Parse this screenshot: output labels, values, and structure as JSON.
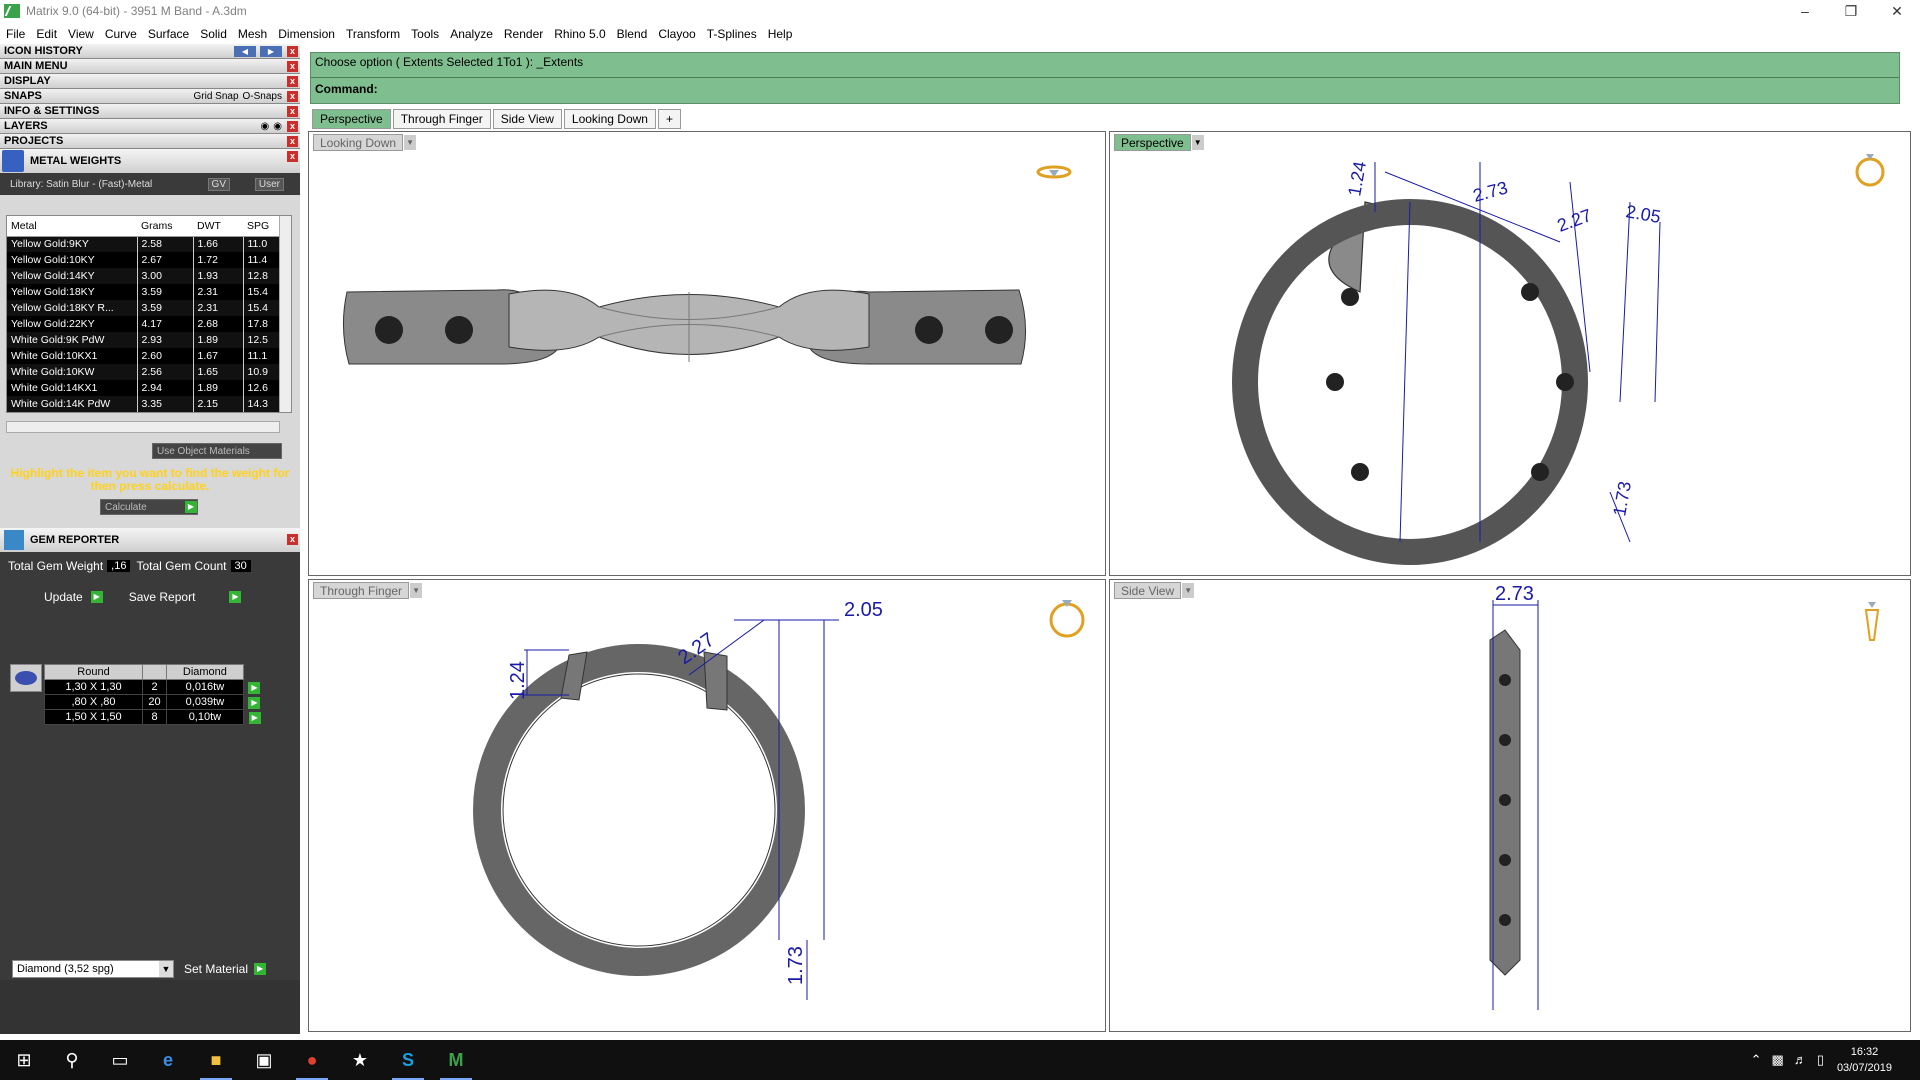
{
  "window": {
    "title": "Matrix 9.0 (64-bit) - 3951 M Band - A.3dm"
  },
  "menu": [
    "File",
    "Edit",
    "View",
    "Curve",
    "Surface",
    "Solid",
    "Mesh",
    "Dimension",
    "Transform",
    "Tools",
    "Analyze",
    "Render",
    "Rhino 5.0",
    "Blend",
    "Clayoo",
    "T-Splines",
    "Help"
  ],
  "panels": {
    "icon_history": "ICON HISTORY",
    "main_menu": "MAIN MENU",
    "display": "DISPLAY",
    "snaps": "SNAPS",
    "grid_snap": "Grid Snap",
    "o_snaps": "O-Snaps",
    "info_settings": "INFO & SETTINGS",
    "layers": "LAYERS",
    "projects": "PROJECTS"
  },
  "metal_weights": {
    "title": "METAL WEIGHTS",
    "library": "Library: Satin Blur - (Fast)-Metal",
    "gv": "GV",
    "user": "User",
    "headers": [
      "Metal",
      "Grams",
      "DWT",
      "SPG"
    ],
    "rows": [
      [
        "Yellow Gold:9KY",
        "2.58",
        "1.66",
        "11.0"
      ],
      [
        "Yellow Gold:10KY",
        "2.67",
        "1.72",
        "11.4"
      ],
      [
        "Yellow Gold:14KY",
        "3.00",
        "1.93",
        "12.8"
      ],
      [
        "Yellow Gold:18KY",
        "3.59",
        "2.31",
        "15.4"
      ],
      [
        "Yellow Gold:18KY R...",
        "3.59",
        "2.31",
        "15.4"
      ],
      [
        "Yellow Gold:22KY",
        "4.17",
        "2.68",
        "17.8"
      ],
      [
        "White Gold:9K PdW",
        "2.93",
        "1.89",
        "12.5"
      ],
      [
        "White Gold:10KX1",
        "2.60",
        "1.67",
        "11.1"
      ],
      [
        "White Gold:10KW",
        "2.56",
        "1.65",
        "10.9"
      ],
      [
        "White Gold:14KX1",
        "2.94",
        "1.89",
        "12.6"
      ],
      [
        "White Gold:14K PdW",
        "3.35",
        "2.15",
        "14.3"
      ]
    ],
    "use_object_materials": "Use Object Materials",
    "hint": "Highlight the item you want to find the weight for then press calculate.",
    "calculate": "Calculate"
  },
  "gem_reporter": {
    "title": "GEM REPORTER",
    "total_weight_label": "Total Gem Weight",
    "total_weight": ",16",
    "total_count_label": "Total Gem Count",
    "total_count": "30",
    "update": "Update",
    "save_report": "Save Report",
    "headers": [
      "Round",
      "",
      "Diamond"
    ],
    "rows": [
      [
        "1,30 X 1,30",
        "2",
        "0,016tw"
      ],
      [
        ",80 X ,80",
        "20",
        "0,039tw"
      ],
      [
        "1,50 X 1,50",
        "8",
        "0,10tw"
      ]
    ],
    "material": "Diamond    (3,52 spg)",
    "set_material": "Set Material"
  },
  "command": {
    "line1": "Choose option ( Extents  Selected  1To1 ): _Extents",
    "line2": "Command:"
  },
  "tabs": [
    "Perspective",
    "Through Finger",
    "Side View",
    "Looking Down",
    "+"
  ],
  "viewports": {
    "top_left": "Looking Down",
    "top_right": "Perspective",
    "bottom_left": "Through Finger",
    "bottom_right": "Side View"
  },
  "dimensions": {
    "persp": [
      "1.24",
      "2.73",
      "2.27",
      "2.05",
      "1.73"
    ],
    "finger": [
      "1.24",
      "2.27",
      "2.05",
      "1.73"
    ],
    "side": [
      "2.73"
    ]
  },
  "taskbar": {
    "time": "16:32",
    "date": "03/07/2019"
  },
  "colors": {
    "command_green": "#7fbf8f",
    "dimension_blue": "#1a1aa8",
    "hint_yellow": "#ffd21a"
  }
}
